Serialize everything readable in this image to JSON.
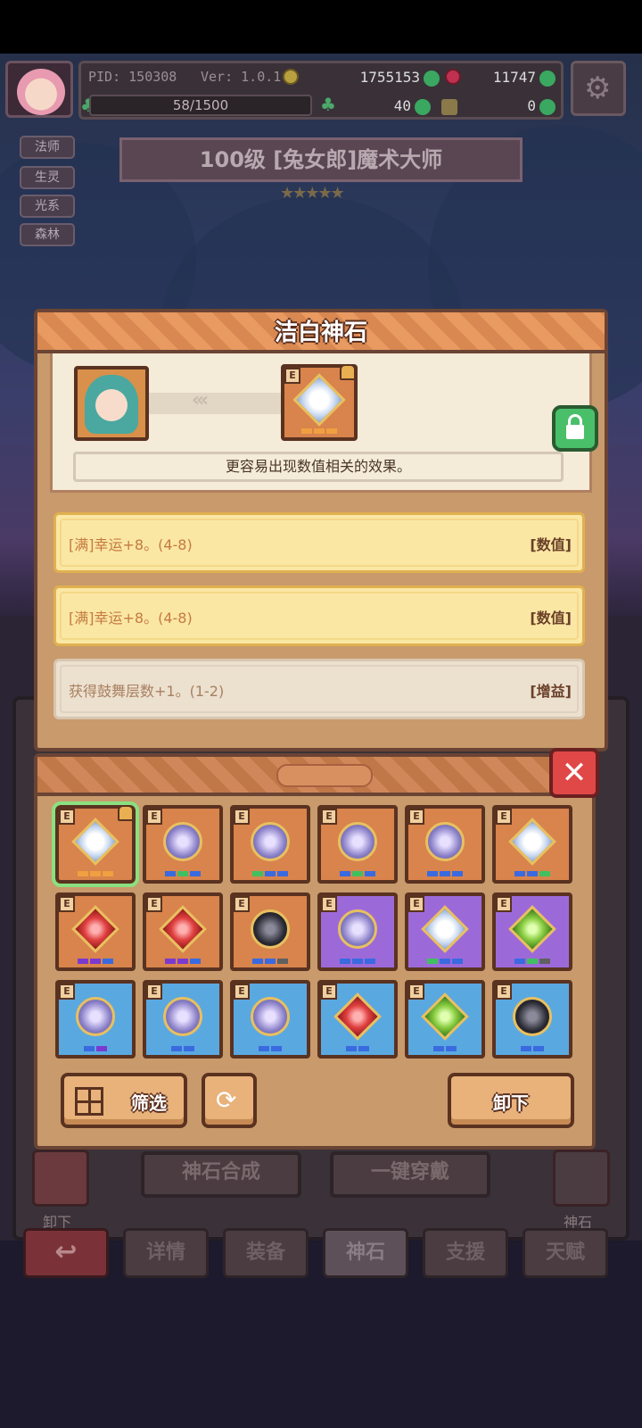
{
  "hud": {
    "pid": "PID: 150308",
    "version": "Ver: 1.0.1.4",
    "gold": "1755153",
    "gems": "11747",
    "exp": "58/1500",
    "clover_count": "40",
    "fragment_count": "0"
  },
  "tags": [
    "法师",
    "生灵",
    "光系",
    "森林"
  ],
  "hero_title": "100级 [兔女郎]魔术大师",
  "hero_stars": "★★★★★",
  "modal": {
    "title": "洁白神石",
    "arrows": "‹‹‹",
    "rarity_letter": "E",
    "description": "更容易出现数值相关的效果。",
    "effects": [
      {
        "text": "[满]幸运+8。(4-8)",
        "type": "[数值]"
      },
      {
        "text": "[满]幸运+8。(4-8)",
        "type": "[数值]"
      },
      {
        "text": "获得鼓舞层数+1。(1-2)",
        "type": "[增益]"
      }
    ]
  },
  "inventory": {
    "close_label": "✕",
    "rarity_letter": "E",
    "filter_label": "筛选",
    "unequip_label": "卸下",
    "refresh_icon": "⟳"
  },
  "colors": {
    "slot_orange": "#d8844c",
    "slot_purple": "#9c6ad8",
    "slot_blue": "#5aa8e0",
    "dot_orange": "#f0a040",
    "dot_blue": "#3a6ae0",
    "dot_green": "#40c060",
    "dot_purple": "#7a3ad0",
    "dot_gray": "#606060"
  },
  "background_ui": {
    "synthesis_label": "神石合成",
    "auto_equip_label": "一键穿戴",
    "left_side_label": "卸下",
    "right_side_label": "神石",
    "back_icon": "↩",
    "tabs": [
      "详情",
      "装备",
      "神石",
      "支援",
      "天赋"
    ]
  }
}
